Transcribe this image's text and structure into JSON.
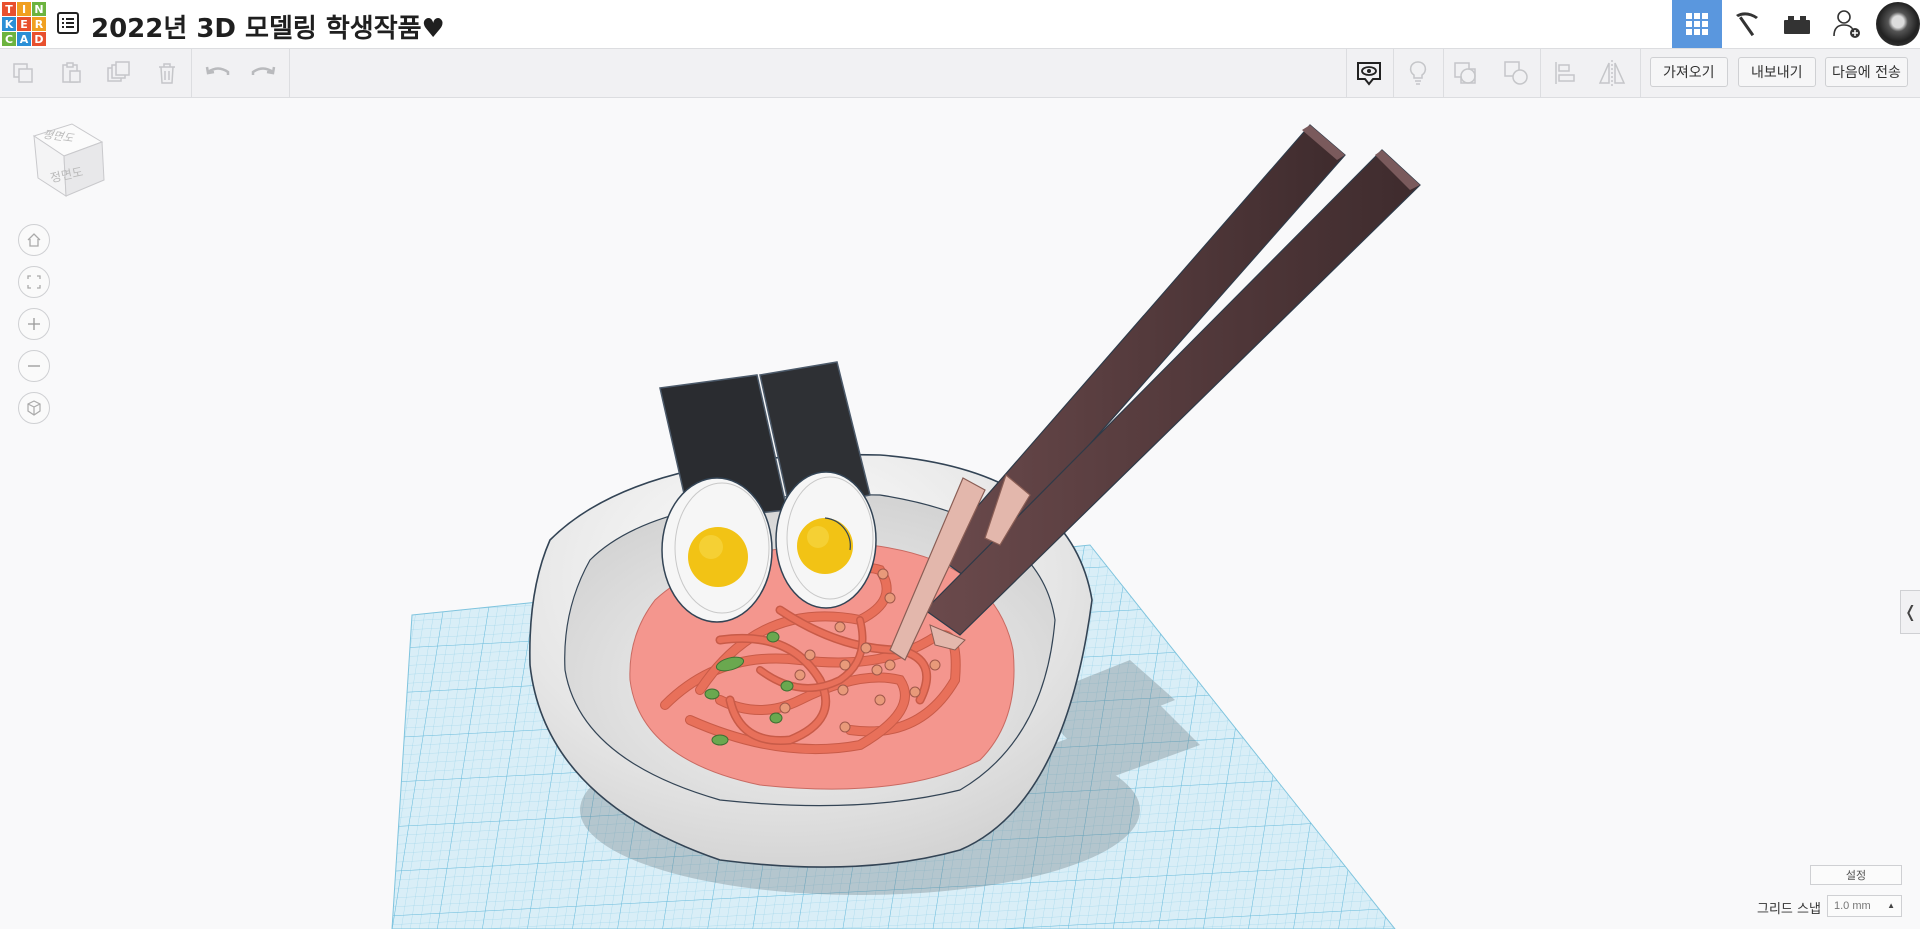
{
  "app": {
    "logo_letters": [
      "T",
      "I",
      "N",
      "K",
      "E",
      "R",
      "C",
      "A",
      "D"
    ],
    "logo_colors": [
      "#e8502e",
      "#f0a020",
      "#6cb33f",
      "#2b8fd6",
      "#e8502e",
      "#f0a020",
      "#6cb33f",
      "#2b8fd6",
      "#e8502e"
    ],
    "title": "2022년 3D 모델링 학생작품♥"
  },
  "toolbar": {
    "import_label": "가져오기",
    "export_label": "내보내기",
    "send_label": "다음에 전송"
  },
  "viewcube": {
    "top_label": "평면도",
    "front_label": "정면도"
  },
  "bottom": {
    "settings_label": "설정",
    "grid_snap_label": "그리드 스냅",
    "grid_snap_value": "1.0 mm"
  },
  "colors": {
    "accent": "#5a97de",
    "grid": "#cfe8f3",
    "bowl": "#ececec",
    "soup": "#f28e86",
    "noodle": "#ee7a60",
    "egg_yolk": "#f2c315",
    "laver": "#2a2c30",
    "chopstick": "#5b3d3f"
  }
}
